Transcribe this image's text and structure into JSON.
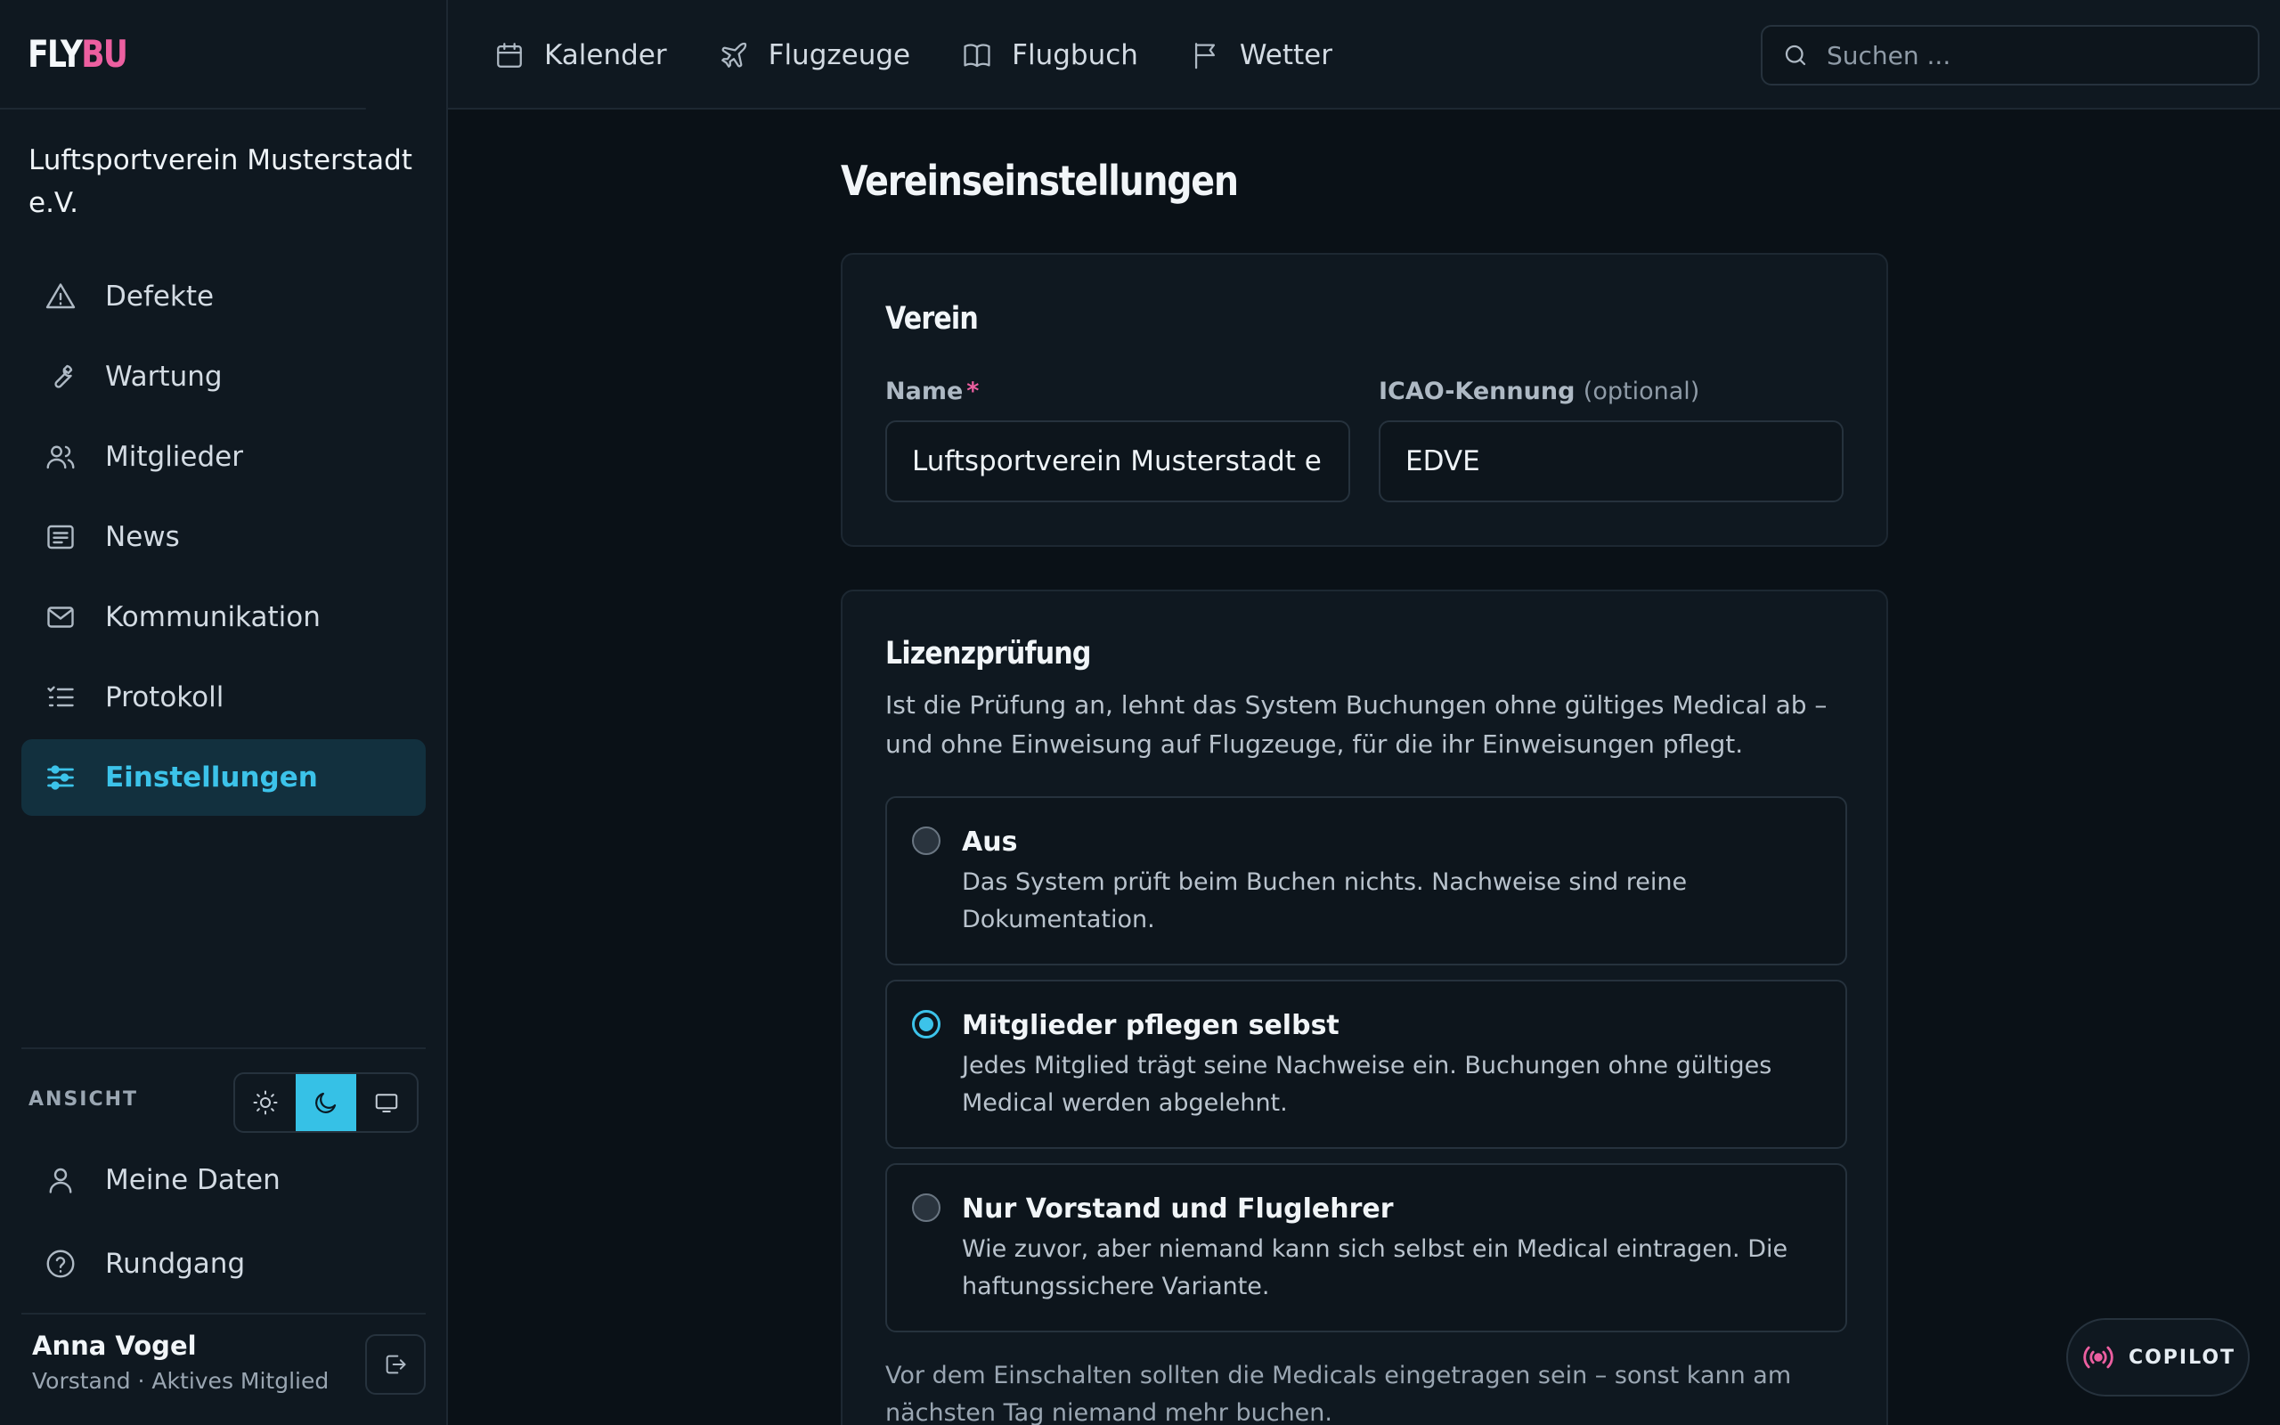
{
  "brand": {
    "part1": "FLY",
    "part2": "BU"
  },
  "colors": {
    "accent": "#3cc3ea",
    "brand_pink": "#ec5fa0",
    "background": "#0a1117",
    "panel": "#0f1820"
  },
  "sidebar": {
    "org_name": "Luftsportverein Musterstadt e.V.",
    "items": [
      {
        "label": "Defekte",
        "icon": "warning-icon"
      },
      {
        "label": "Wartung",
        "icon": "wrench-icon"
      },
      {
        "label": "Mitglieder",
        "icon": "users-icon"
      },
      {
        "label": "News",
        "icon": "news-icon"
      },
      {
        "label": "Kommunikation",
        "icon": "mail-icon"
      },
      {
        "label": "Protokoll",
        "icon": "list-icon"
      },
      {
        "label": "Einstellungen",
        "icon": "sliders-icon",
        "active": true
      }
    ],
    "view_label": "ANSICHT",
    "theme_selected": "dark",
    "my_data_label": "Meine Daten",
    "tour_label": "Rundgang",
    "user": {
      "name": "Anna Vogel",
      "role": "Vorstand · Aktives Mitglied"
    }
  },
  "topnav": {
    "items": [
      {
        "label": "Kalender",
        "icon": "calendar-icon"
      },
      {
        "label": "Flugzeuge",
        "icon": "plane-icon"
      },
      {
        "label": "Flugbuch",
        "icon": "book-icon"
      },
      {
        "label": "Wetter",
        "icon": "flag-icon"
      }
    ],
    "search_placeholder": "Suchen ..."
  },
  "main": {
    "page_title": "Vereinseinstellungen",
    "club_card": {
      "title": "Verein",
      "name_label": "Name",
      "name_required": "*",
      "name_value": "Luftsportverein Musterstadt e.V.",
      "icao_label": "ICAO-Kennung",
      "icao_optional": "(optional)",
      "icao_value": "EDVE"
    },
    "license_card": {
      "title": "Lizenzprüfung",
      "description": "Ist die Prüfung an, lehnt das System Buchungen ohne gültiges Medical ab – und ohne Einweisung auf Flugzeuge, für die ihr Einweisungen pflegt.",
      "selected_option": "Mitglieder pflegen selbst",
      "options": [
        {
          "title": "Aus",
          "desc": "Das System prüft beim Buchen nichts. Nachweise sind reine Dokumentation."
        },
        {
          "title": "Mitglieder pflegen selbst",
          "desc": "Jedes Mitglied trägt seine Nachweise ein. Buchungen ohne gültiges Medical werden abgelehnt."
        },
        {
          "title": "Nur Vorstand und Fluglehrer",
          "desc": "Wie zuvor, aber niemand kann sich selbst ein Medical eintragen. Die haftungssichere Variante."
        }
      ],
      "note": "Vor dem Einschalten sollten die Medicals eingetragen sein – sonst kann am nächsten Tag niemand mehr buchen."
    }
  },
  "copilot_label": "COPILOT"
}
